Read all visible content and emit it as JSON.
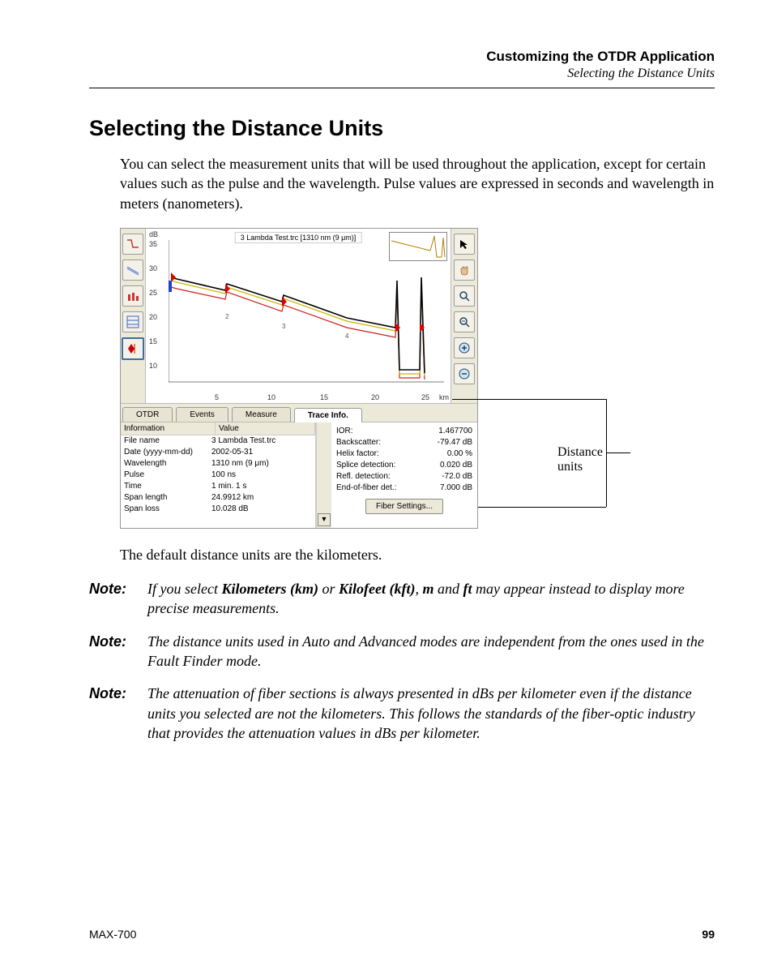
{
  "header": {
    "title": "Customizing the OTDR Application",
    "subtitle": "Selecting the Distance Units"
  },
  "heading": "Selecting the Distance Units",
  "intro": "You can select the measurement units that will be used throughout the application, except for certain values such as the pulse and the wavelength. Pulse values are expressed in seconds and wavelength in meters (nanometers).",
  "callout": "Distance units",
  "after_fig": "The default distance units are the kilometers.",
  "notes": [
    {
      "label": "Note:",
      "html": "If you select <b>Kilometers (km)</b> or <b>Kilofeet (kft)</b>, <b>m</b> and <b>ft</b> may appear instead to display more precise measurements."
    },
    {
      "label": "Note:",
      "html": "The distance units used in Auto and Advanced modes are independent from the ones used in the Fault Finder mode."
    },
    {
      "label": "Note:",
      "html": "The attenuation of fiber sections is always presented in dBs per kilometer even if the distance units you selected are not the kilometers. This follows the standards of the fiber-optic industry that provides the attenuation values in dBs per kilometer."
    }
  ],
  "footer": {
    "model": "MAX-700",
    "page": "99"
  },
  "shot": {
    "plot_title": "3 Lambda Test.trc [1310 nm (9 μm)]",
    "y_unit": "dB",
    "y_ticks": [
      "35",
      "30",
      "25",
      "20",
      "15",
      "10"
    ],
    "x_ticks": [
      "5",
      "10",
      "15",
      "20",
      "25"
    ],
    "x_unit": "km",
    "markers": [
      "2",
      "3",
      "4"
    ],
    "tabs": [
      "OTDR",
      "Events",
      "Measure",
      "Trace Info."
    ],
    "active_tab": 3,
    "left_header": {
      "info": "Information",
      "value": "Value"
    },
    "left_rows": [
      {
        "k": "File name",
        "v": "3 Lambda Test.trc"
      },
      {
        "k": "Date (yyyy-mm-dd)",
        "v": "2002-05-31"
      },
      {
        "k": "Wavelength",
        "v": "1310 nm (9 μm)"
      },
      {
        "k": "Pulse",
        "v": "100 ns"
      },
      {
        "k": "Time",
        "v": "1 min. 1 s"
      },
      {
        "k": "Span length",
        "v": "24.9912 km"
      },
      {
        "k": "Span loss",
        "v": "10.028 dB"
      }
    ],
    "right_rows": [
      {
        "k": "IOR:",
        "v": "1.467700"
      },
      {
        "k": "Backscatter:",
        "v": "-79.47 dB"
      },
      {
        "k": "Helix factor:",
        "v": "0.00 %"
      },
      {
        "k": "Splice detection:",
        "v": "0.020 dB"
      },
      {
        "k": "Refl. detection:",
        "v": "-72.0 dB"
      },
      {
        "k": "End-of-fiber det.:",
        "v": "7.000 dB"
      }
    ],
    "fiber_btn": "Fiber Settings..."
  },
  "chart_data": {
    "type": "line",
    "title": "3 Lambda Test.trc [1310 nm (9 μm)]",
    "xlabel": "km",
    "ylabel": "dB",
    "xlim": [
      0,
      27
    ],
    "ylim": [
      8,
      37
    ],
    "x": [
      0,
      5,
      10,
      15,
      20,
      23,
      25
    ],
    "series": [
      {
        "name": "trace1",
        "color": "#c00",
        "values": [
          25,
          23,
          21,
          19,
          17,
          15,
          10
        ]
      },
      {
        "name": "trace2",
        "color": "#cc0",
        "values": [
          26,
          24,
          22,
          20,
          18,
          16,
          10
        ]
      },
      {
        "name": "trace3",
        "color": "#000",
        "values": [
          26,
          24.5,
          22.5,
          20.5,
          18.5,
          17,
          10
        ]
      }
    ],
    "event_markers_km": [
      0.2,
      5.5,
      10.5,
      17.5,
      23,
      25
    ]
  }
}
